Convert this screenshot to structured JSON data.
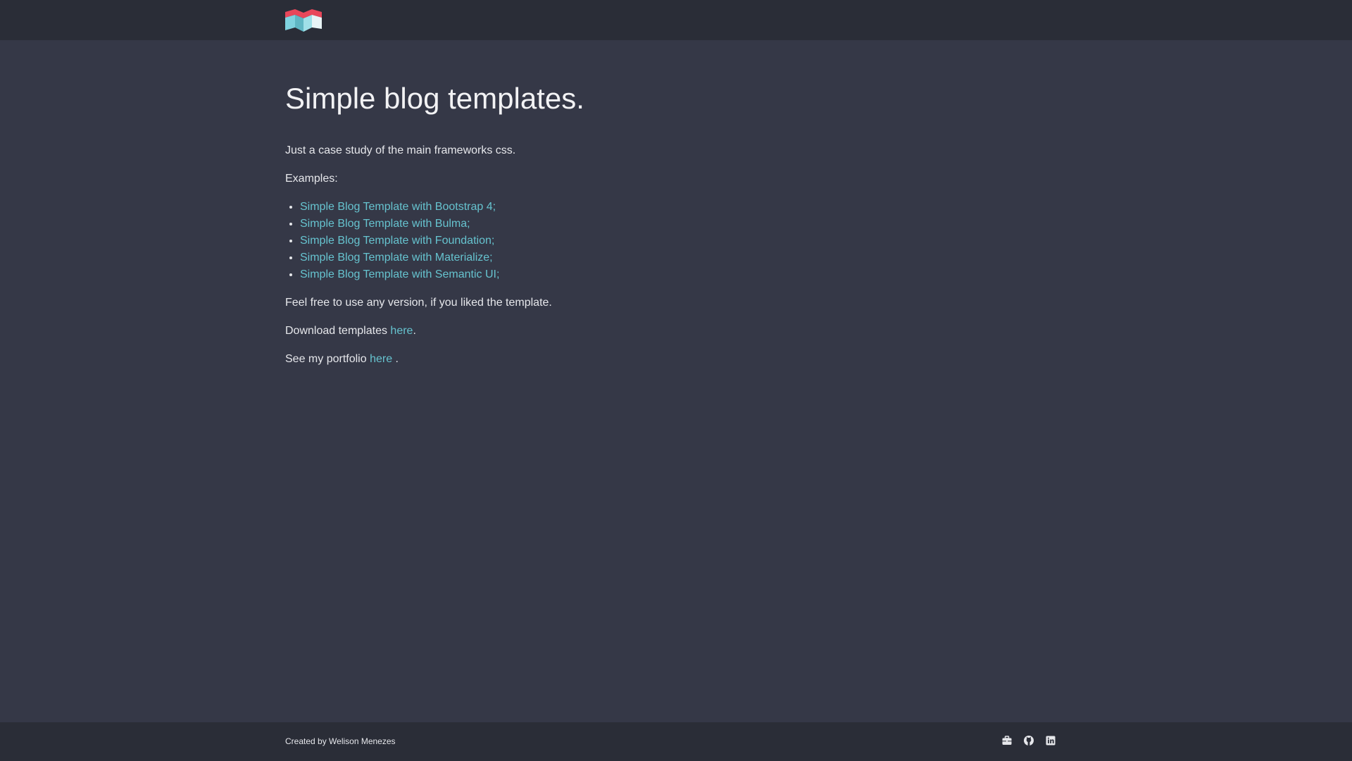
{
  "header": {
    "logo_icon": "m-logo-icon",
    "colors": {
      "background": "#2a2d37",
      "logo_red": "#e8475a",
      "logo_teal": "#7fd3df"
    }
  },
  "main": {
    "title": "Simple blog templates.",
    "intro": "Just a case study of the main frameworks css.",
    "examples_label": "Examples:",
    "examples": [
      "Simple Blog Template with Bootstrap 4;",
      "Simple Blog Template with Bulma;",
      "Simple Blog Template with Foundation;",
      "Simple Blog Template with Materialize;",
      "Simple Blog Template with Semantic UI;"
    ],
    "feel_free": "Feel free to use any version, if you liked the template.",
    "download_prefix": "Download templates ",
    "download_link": "here",
    "download_suffix": ".",
    "portfolio_prefix": "See my portfolio ",
    "portfolio_link": "here",
    "portfolio_suffix": " .",
    "colors": {
      "background": "#353847",
      "link": "#66c3cf",
      "text": "#e6e7eb"
    }
  },
  "footer": {
    "created_by": "Created by Welison Menezes",
    "icons": [
      "briefcase-icon",
      "github-icon",
      "linkedin-icon"
    ]
  }
}
